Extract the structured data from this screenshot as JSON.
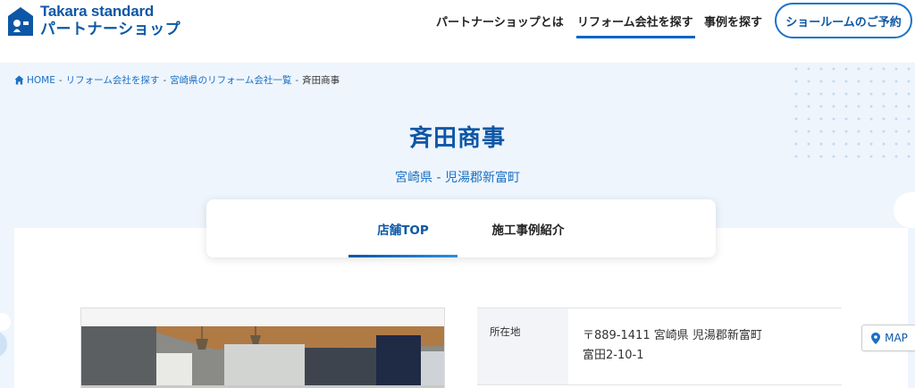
{
  "header": {
    "logo": {
      "line1": "Takara standard",
      "line2": "パートナーショップ"
    },
    "nav": [
      {
        "label": "パートナーショップとは"
      },
      {
        "label": "リフォーム会社を探す",
        "active": true
      },
      {
        "label": "事例を探す"
      }
    ],
    "reserve_button": "ショールームのご予約"
  },
  "breadcrumb": {
    "items": [
      "HOME",
      "リフォーム会社を探す",
      "宮崎県のリフォーム会社一覧",
      "斉田商事"
    ],
    "separator": "-"
  },
  "shop": {
    "name": "斉田商事",
    "location": "宮崎県 - 児湯郡新富町"
  },
  "tabs": [
    {
      "label": "店舗TOP",
      "active": true
    },
    {
      "label": "施工事例紹介",
      "active": false
    }
  ],
  "info": {
    "address_label": "所在地",
    "address_value": "〒889-1411 宮崎県 児湯郡新富町 富田2-10-1",
    "map_button": "MAP"
  },
  "colors": {
    "brand": "#0d57a6",
    "accent": "#1a6fc4",
    "background": "#eef5fd"
  },
  "icons": [
    "logo-house-icon",
    "home-icon",
    "map-pin-icon"
  ]
}
